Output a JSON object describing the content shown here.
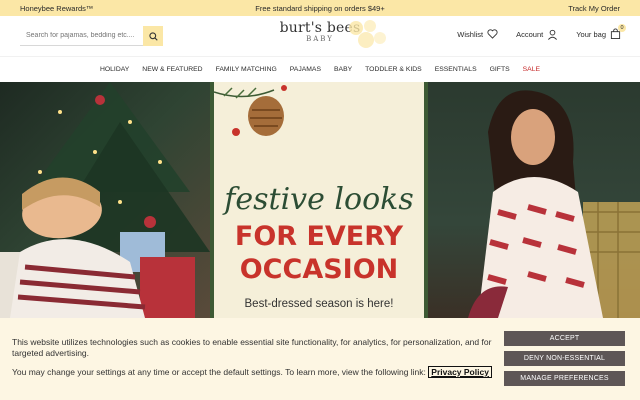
{
  "topbar": {
    "rewards": "Honeybee Rewards™",
    "shipping": "Free standard shipping on orders $49+",
    "track": "Track My Order"
  },
  "header": {
    "search_placeholder": "Search for pajamas, bedding etc....",
    "logo_main": "burt's bees",
    "logo_sub": "BABY",
    "wishlist": "Wishlist",
    "account": "Account",
    "bag": "Your bag",
    "bag_count": "0"
  },
  "nav": {
    "items": [
      "HOLIDAY",
      "NEW & FEATURED",
      "FAMILY MATCHING",
      "PAJAMAS",
      "BABY",
      "TODDLER & KIDS",
      "ESSENTIALS",
      "GIFTS",
      "SALE"
    ]
  },
  "hero": {
    "line1": "festive looks",
    "line2": "FOR EVERY",
    "line3": "OCCASION",
    "tagline": "Best-dressed season is here!"
  },
  "cookie": {
    "text1": "This website utilizes technologies such as cookies to enable essential site functionality, for analytics, for personalization, and for targeted advertising.",
    "text2": "You may change your settings at any time or accept the default settings. To learn more, view the following link:",
    "link": "Privacy Policy",
    "accept": "ACCEPT",
    "deny": "DENY NON-ESSENTIAL",
    "manage": "MANAGE PREFERENCES"
  },
  "colors": {
    "topbar": "#fbe7a6",
    "sale": "#c62828",
    "hero_red": "#c8332b",
    "hero_green": "#2c4d34",
    "cookie_bg": "#fdf6e3",
    "button": "#5e5656"
  }
}
